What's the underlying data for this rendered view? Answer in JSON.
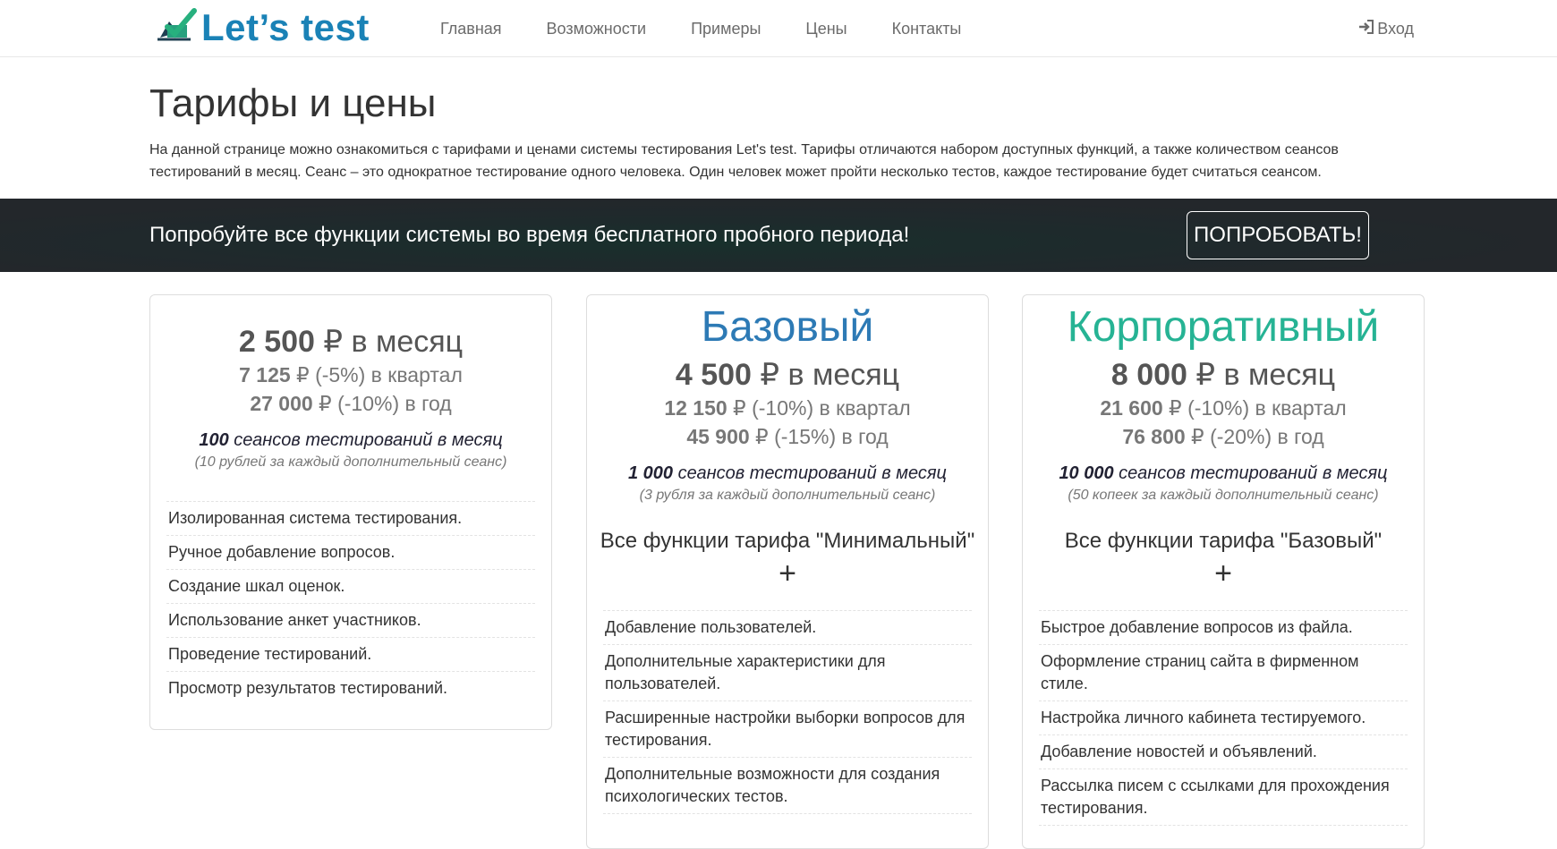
{
  "brand": {
    "name": "Let’s test",
    "logo_icon": "checkmark-logo-icon"
  },
  "nav": {
    "items": [
      "Главная",
      "Возможности",
      "Примеры",
      "Цены",
      "Контакты"
    ]
  },
  "login": {
    "label": "Вход",
    "icon": "sign-in-icon"
  },
  "page": {
    "title": "Тарифы и цены",
    "intro": "На данной странице можно ознакомиться с тарифами и ценами системы тестирования Let's test. Тарифы отличаются набором доступных функций, а также количеством сеансов тестирований в месяц. Сеанс – это однократное тестирование одного человека. Один человек может пройти несколько тестов, каждое тестирование будет считаться сеансом."
  },
  "banner": {
    "text": "Попробуйте все функции системы во время бесплатного пробного периода!",
    "button": "ПОПРОБОВАТЬ!"
  },
  "plans": [
    {
      "name": "",
      "price_month": "2 500",
      "price_month_suffix": " ₽ в месяц",
      "price_quarter": "7 125",
      "price_quarter_suffix": " ₽ (-5%) в квартал",
      "price_year": "27 000",
      "price_year_suffix": " ₽ (-10%) в год",
      "sessions_count": "100",
      "sessions_suffix": " сеансов тестирований в месяц",
      "note": "(10 рублей за каждый дополнительный сеанс)",
      "includes": "",
      "features": [
        "Изолированная система тестирования.",
        "Ручное добавление вопросов.",
        "Создание шкал оценок.",
        "Использование анкет участников.",
        "Проведение тестирований.",
        "Просмотр результатов тестирований."
      ]
    },
    {
      "name": "Базовый",
      "price_month": "4 500",
      "price_month_suffix": " ₽ в месяц",
      "price_quarter": "12 150",
      "price_quarter_suffix": " ₽ (-10%) в квартал",
      "price_year": "45 900",
      "price_year_suffix": " ₽ (-15%) в год",
      "sessions_count": "1 000",
      "sessions_suffix": " сеансов тестирований в месяц",
      "note": "(3 рубля за каждый дополнительный сеанс)",
      "includes": "Все функции тарифа \"Минимальный\"",
      "plus": "+",
      "features": [
        "Добавление пользователей.",
        "Дополнительные характеристики для пользователей.",
        "Расширенные настройки выборки вопросов для тестирования.",
        "Дополнительные возможности для создания психологических тестов."
      ]
    },
    {
      "name": "Корпоративный",
      "price_month": "8 000",
      "price_month_suffix": " ₽ в месяц",
      "price_quarter": "21 600",
      "price_quarter_suffix": " ₽ (-10%) в квартал",
      "price_year": "76 800",
      "price_year_suffix": " ₽ (-20%) в год",
      "sessions_count": "10 000",
      "sessions_suffix": " сеансов тестирований в месяц",
      "note": "(50 копеек за каждый дополнительный сеанс)",
      "includes": "Все функции тарифа \"Базовый\"",
      "plus": "+",
      "features": [
        "Быстрое добавление вопросов из файла.",
        "Оформление страниц сайта в фирменном стиле.",
        "Настройка личного кабинета тестируемого.",
        "Добавление новостей и объявлений.",
        "Рассылка писем с ссылками для прохождения тестирования."
      ]
    }
  ],
  "colors": {
    "brand_blue": "#1a82b6",
    "brand_green": "#26b394",
    "banner_dark": "#23272b",
    "basic_title": "#2d7ab5"
  }
}
